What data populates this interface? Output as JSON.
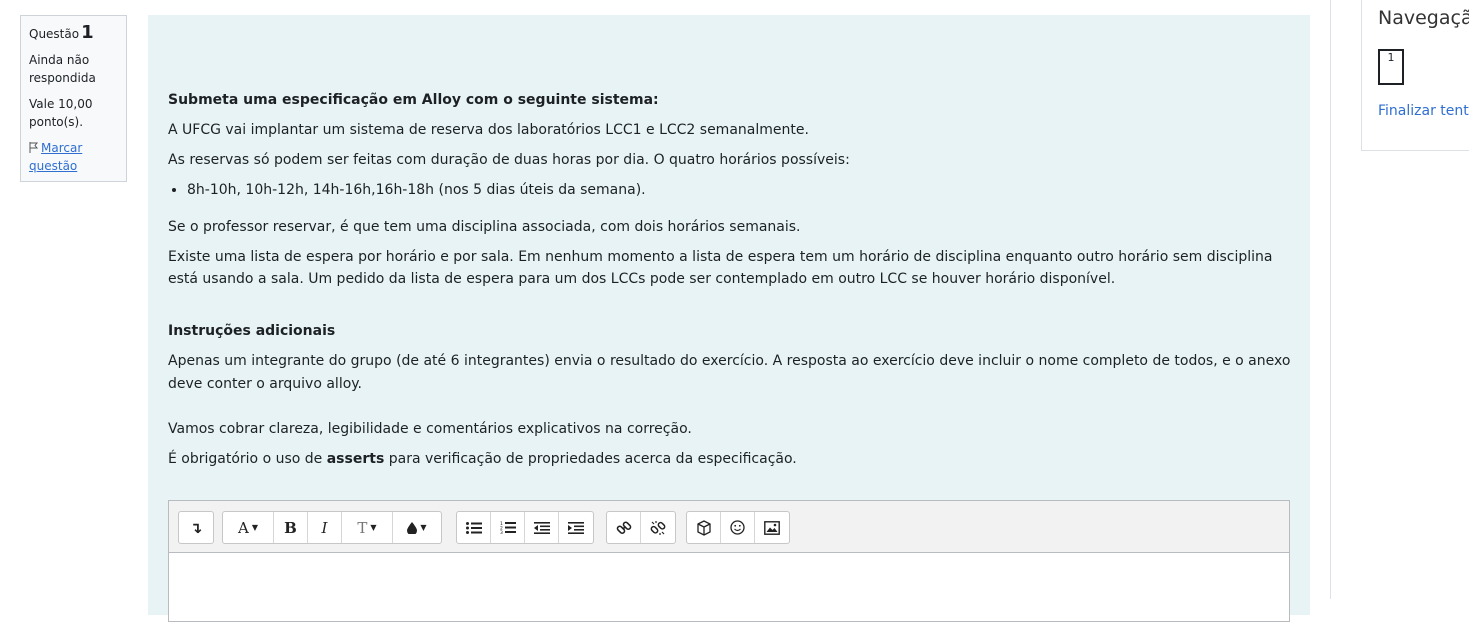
{
  "info": {
    "question_label": "Questão",
    "question_number": "1",
    "state": "Ainda não respondida",
    "grade": "Vale 10,00 ponto(s).",
    "flag": "Marcar questão"
  },
  "question": {
    "heading": "Submeta uma especificação em Alloy com o seguinte sistema:",
    "p1": "A UFCG vai implantar um sistema de reserva dos laboratórios LCC1 e LCC2 semanalmente.",
    "p2": "As reservas só podem ser feitas com duração de duas horas por dia. O quatro horários possíveis:",
    "bullet": "8h-10h, 10h-12h, 14h-16h,16h-18h (nos 5 dias úteis da semana).",
    "p3": "Se o professor reservar, é que tem uma disciplina associada, com dois horários semanais.",
    "p4": "Existe uma lista de espera por horário e por sala. Em nenhum momento a lista de espera tem um horário de disciplina enquanto outro horário sem disciplina está usando a sala. Um pedido da lista de espera para um dos LCCs pode ser contemplado em outro LCC se houver horário disponível.",
    "instructions_heading": "Instruções adicionais",
    "p5": "Apenas um integrante do grupo (de até 6 integrantes) envia o resultado do exercício. A resposta ao exercício deve incluir o nome completo de todos, e o anexo deve conter o arquivo alloy.",
    "p6": "Vamos cobrar clareza, legibilidade e comentários explicativos na correção.",
    "p7_before": "É obrigatório o uso de ",
    "p7_bold": "asserts",
    "p7_after": " para verificação de propriedades acerca da especificação."
  },
  "toolbar": {
    "expand": "↴",
    "font": "A",
    "bold": "B",
    "italic": "I",
    "text_size": "T",
    "color": "●"
  },
  "nav": {
    "title": "Navegação do questionário",
    "q1": "1",
    "finish": "Finalizar tentativa ..."
  }
}
